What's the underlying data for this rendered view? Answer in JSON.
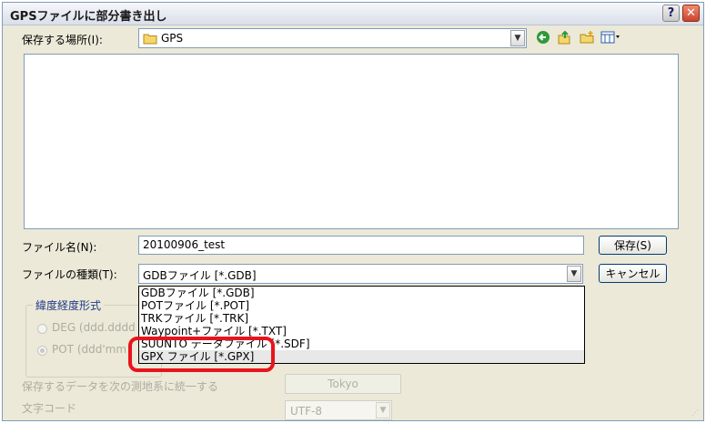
{
  "window": {
    "title": "GPSファイルに部分書き出し",
    "help_label": "?",
    "close_label": "✕"
  },
  "save_in": {
    "label": "保存する場所(I):",
    "value": "GPS"
  },
  "filename": {
    "label": "ファイル名(N):",
    "value": "20100906_test"
  },
  "filetype": {
    "label": "ファイルの種類(T):",
    "value": "GDBファイル [*.GDB]",
    "options": [
      "GDBファイル [*.GDB]",
      "POTファイル [*.POT]",
      "TRKファイル [*.TRK]",
      "Waypoint+ファイル [*.TXT]",
      "SUUNTO データファイル [*.SDF]",
      "GPX ファイル [*.GPX]"
    ],
    "selected_option": "GPX ファイル [*.GPX]"
  },
  "buttons": {
    "save": "保存(S)",
    "cancel": "キャンセル"
  },
  "coord_format": {
    "title": "緯度経度形式",
    "option1": "DEG (ddd.dddd",
    "option2": "POT (ddd'mm"
  },
  "datum": {
    "label": "保存するデータを次の測地系に統一する",
    "button": "Tokyo"
  },
  "encoding": {
    "label": "文字コード",
    "value": "UTF-8"
  }
}
